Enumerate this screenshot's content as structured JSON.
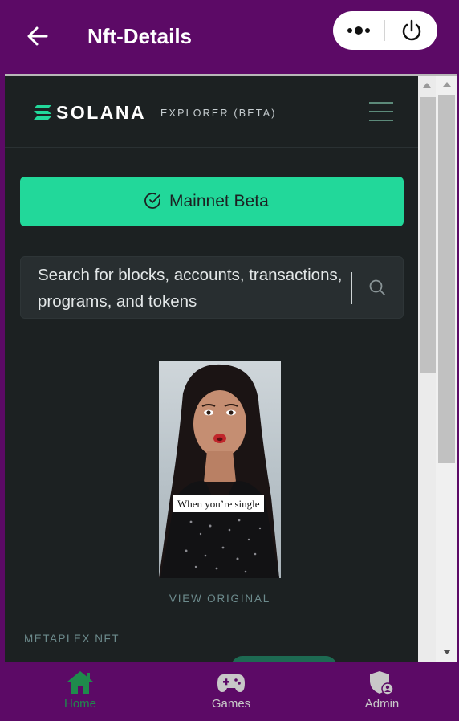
{
  "header": {
    "title": "Nft-Details",
    "back_icon": "arrow-left-icon",
    "more_icon": "more-dots-icon",
    "power_icon": "power-icon"
  },
  "explorer": {
    "logo_icon": "solana-logo-icon",
    "wordmark": "SOLANA",
    "tag": "EXPLORER (BETA)",
    "menu_icon": "hamburger-icon",
    "cluster": {
      "label": "Mainnet Beta",
      "icon": "check-circle-icon"
    },
    "search": {
      "placeholder": "Search for blocks, accounts, transactions, programs, and tokens",
      "icon": "search-icon"
    },
    "nft": {
      "caption": "When you’re single",
      "view_original": "VIEW ORIGINAL",
      "kicker": "METAPLEX NFT"
    }
  },
  "tabbar": {
    "active": "Home",
    "items": [
      {
        "label": "Home",
        "icon": "home-icon",
        "color": "#1f8a4c"
      },
      {
        "label": "Games",
        "icon": "gamepad-icon",
        "color": "#c8c8c8"
      },
      {
        "label": "Admin",
        "icon": "admin-shield-icon",
        "color": "#c8c8c8"
      }
    ]
  },
  "colors": {
    "brand": "#5c0a66",
    "accent": "#22d89a",
    "explorer_bg": "#1c2122"
  }
}
